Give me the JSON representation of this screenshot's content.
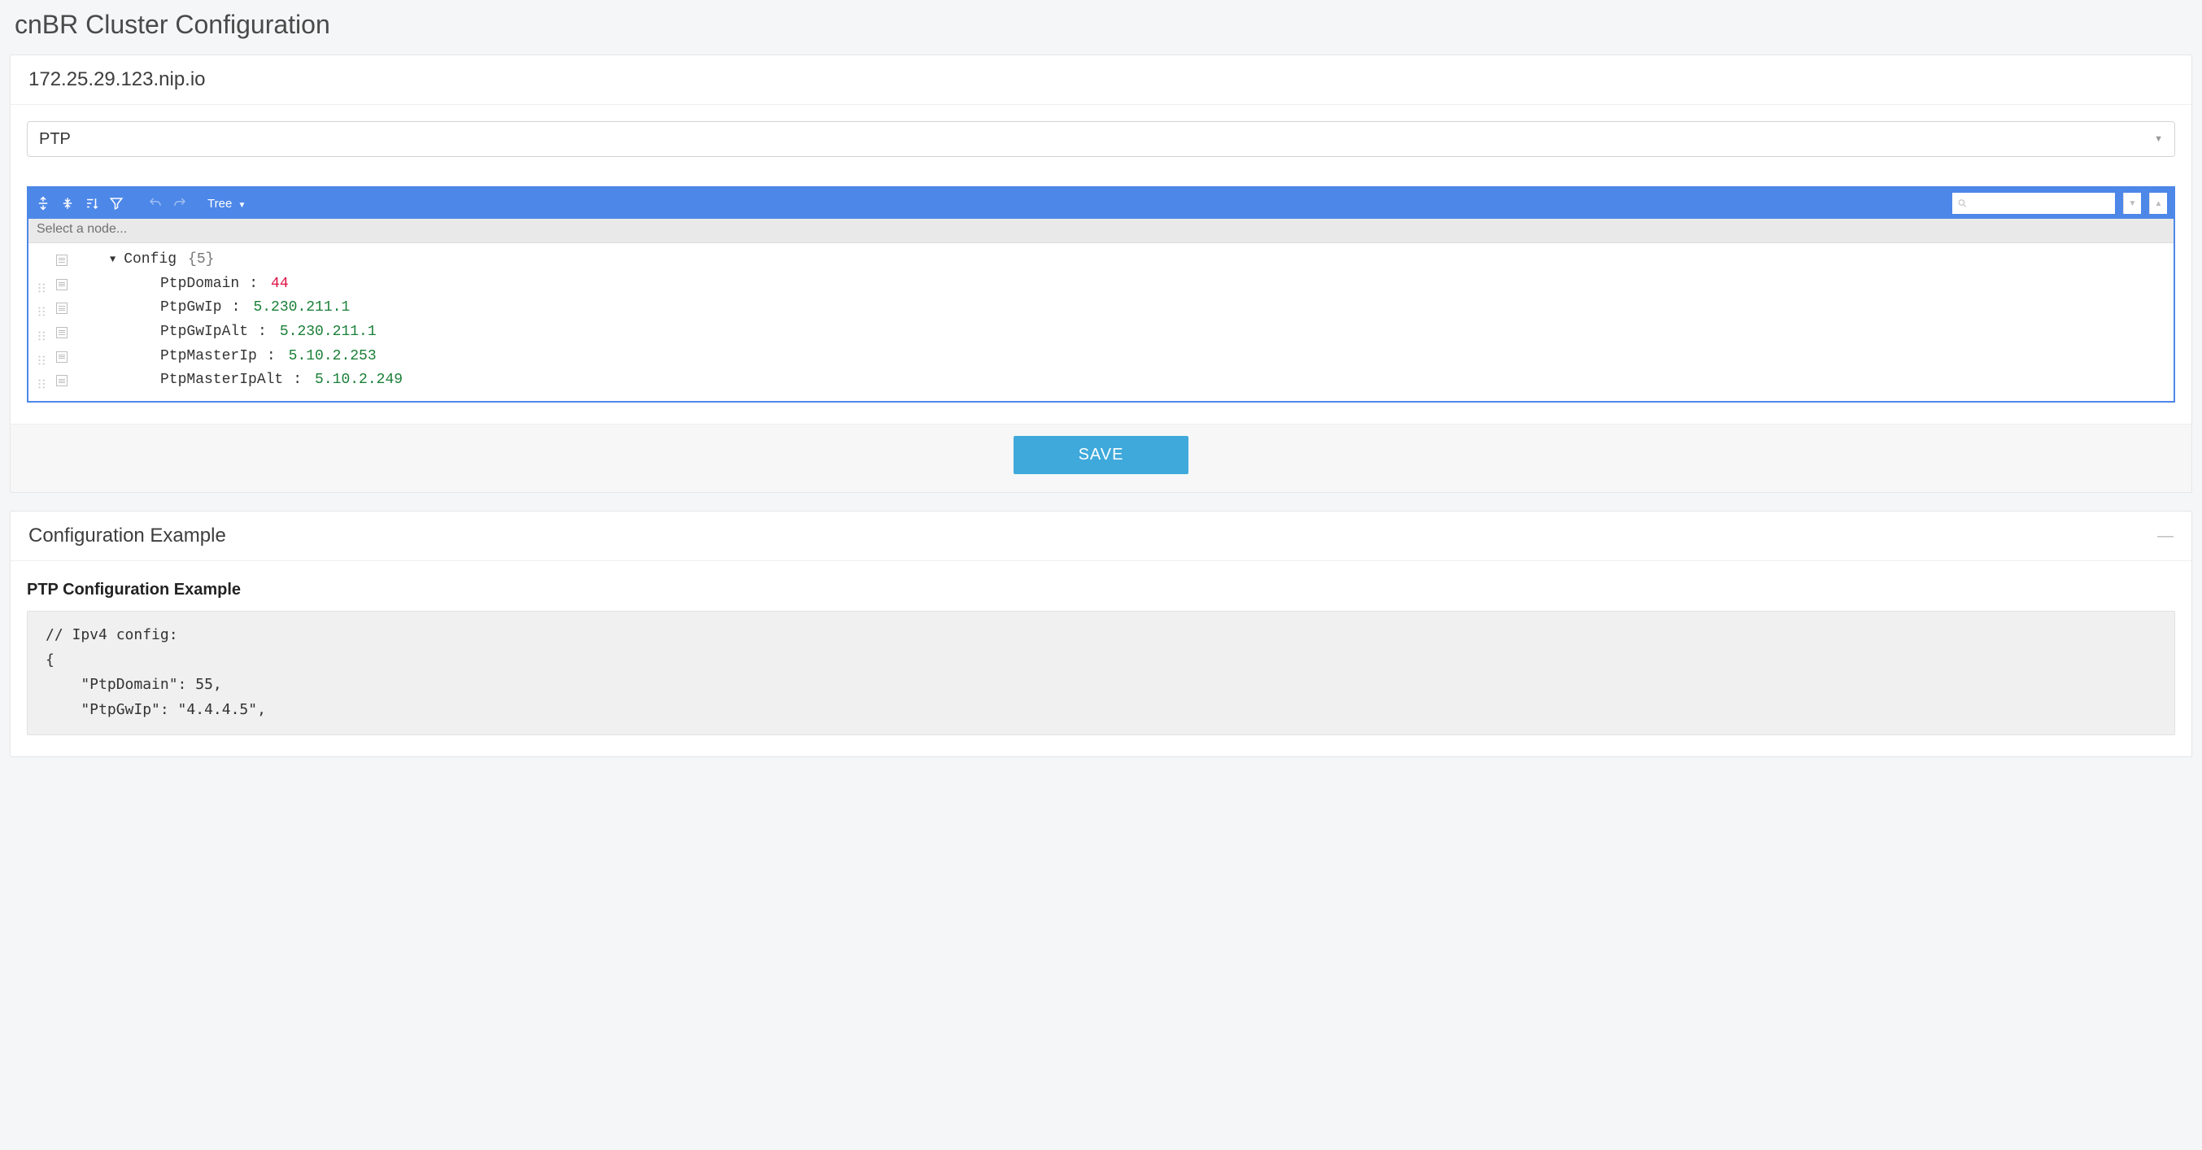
{
  "page": {
    "title": "cnBR Cluster Configuration"
  },
  "host_panel": {
    "title": "172.25.29.123.nip.io",
    "dropdown": {
      "selected": "PTP"
    },
    "editor": {
      "mode_label": "Tree",
      "search_placeholder": "",
      "node_path_placeholder": "Select a node...",
      "tree": {
        "root": {
          "key": "Config",
          "count_label": "{5}"
        },
        "entries": [
          {
            "key": "PtpDomain",
            "value": "44",
            "type": "number"
          },
          {
            "key": "PtpGwIp",
            "value": "5.230.211.1",
            "type": "string"
          },
          {
            "key": "PtpGwIpAlt",
            "value": "5.230.211.1",
            "type": "string"
          },
          {
            "key": "PtpMasterIp",
            "value": "5.10.2.253",
            "type": "string"
          },
          {
            "key": "PtpMasterIpAlt",
            "value": "5.10.2.249",
            "type": "string"
          }
        ]
      }
    },
    "save_label": "SAVE"
  },
  "example_panel": {
    "title": "Configuration Example",
    "subtitle": "PTP Configuration Example",
    "code": "// Ipv4 config:\n{\n    \"PtpDomain\": 55,\n    \"PtpGwIp\": \"4.4.4.5\","
  }
}
